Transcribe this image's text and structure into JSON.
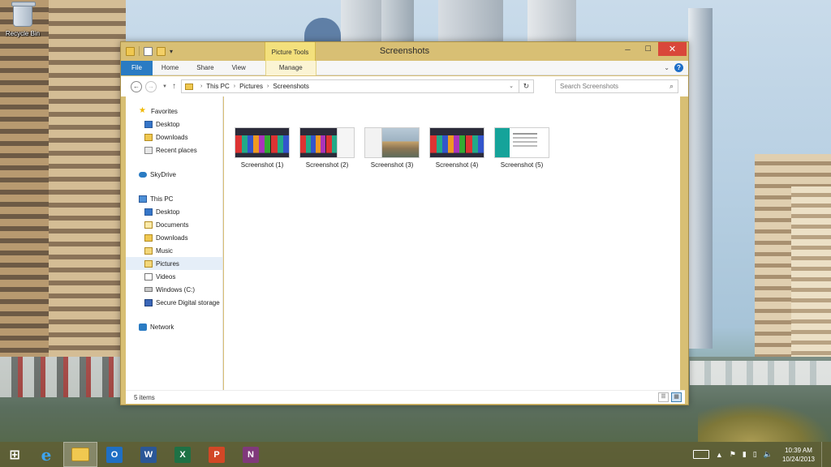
{
  "desktop": {
    "icons": [
      {
        "label": "Recycle Bin",
        "icon": "recycle-bin-icon"
      }
    ]
  },
  "window": {
    "title": "Screenshots",
    "contextual_tab_group": "Picture Tools",
    "caption_buttons": {
      "minimize": "─",
      "maximize": "☐",
      "close": "✕"
    },
    "ribbon_tabs": [
      {
        "label": "File"
      },
      {
        "label": "Home"
      },
      {
        "label": "Share"
      },
      {
        "label": "View"
      },
      {
        "label": "Manage"
      }
    ],
    "ribbon_collapse_glyph": "⌄",
    "help_glyph": "?",
    "nav": {
      "back": "←",
      "forward": "→",
      "recent": "▼",
      "up": "↑",
      "refresh": "↻"
    },
    "address": {
      "crumbs": [
        "This PC",
        "Pictures",
        "Screenshots"
      ],
      "separator": "›",
      "dropdown": "⌄"
    },
    "search": {
      "placeholder": "Search Screenshots",
      "icon_glyph": "⌕"
    },
    "nav_pane": {
      "favorites": {
        "label": "Favorites",
        "icon_glyph": "★",
        "items": [
          "Desktop",
          "Downloads",
          "Recent places"
        ]
      },
      "skydrive": {
        "label": "SkyDrive"
      },
      "this_pc": {
        "label": "This PC",
        "items": [
          "Desktop",
          "Documents",
          "Downloads",
          "Music",
          "Pictures",
          "Videos",
          "Windows (C:)",
          "Secure Digital storage"
        ]
      },
      "network": {
        "label": "Network"
      },
      "selected": "Pictures"
    },
    "files": [
      {
        "name": "Screenshot (1)",
        "thumb": "start-screen"
      },
      {
        "name": "Screenshot (2)",
        "thumb": "start-screen-snapped"
      },
      {
        "name": "Screenshot (3)",
        "thumb": "desktop-city"
      },
      {
        "name": "Screenshot (4)",
        "thumb": "start-screen"
      },
      {
        "name": "Screenshot (5)",
        "thumb": "app-settings"
      }
    ],
    "status": {
      "item_count": "5 items"
    },
    "view_buttons": {
      "details": "☰",
      "large_icons": "▦"
    }
  },
  "taskbar": {
    "start_glyph": "⊞",
    "apps": [
      {
        "name": "Internet Explorer",
        "icon": "internet-explorer-icon",
        "glyph": "e"
      },
      {
        "name": "File Explorer",
        "icon": "file-explorer-icon",
        "glyph": "",
        "active": true
      },
      {
        "name": "Outlook",
        "icon": "outlook-icon",
        "glyph": "O"
      },
      {
        "name": "Word",
        "icon": "word-icon",
        "glyph": "W"
      },
      {
        "name": "Excel",
        "icon": "excel-icon",
        "glyph": "X"
      },
      {
        "name": "PowerPoint",
        "icon": "powerpoint-icon",
        "glyph": "P"
      },
      {
        "name": "OneNote",
        "icon": "onenote-icon",
        "glyph": "N"
      }
    ],
    "tray": {
      "expand_glyph": "▲",
      "flag_glyph": "⚑",
      "network_glyph": "▮",
      "battery_glyph": "▯",
      "volume_glyph": "🔈",
      "time": "10:39 AM",
      "date": "10/24/2013"
    }
  },
  "colors": {
    "window_frame": "#d8bf74",
    "file_tab": "#2a7bc3",
    "close_button": "#d9473a",
    "context_tab": "#f3e07c",
    "taskbar": "#5f5c30"
  }
}
